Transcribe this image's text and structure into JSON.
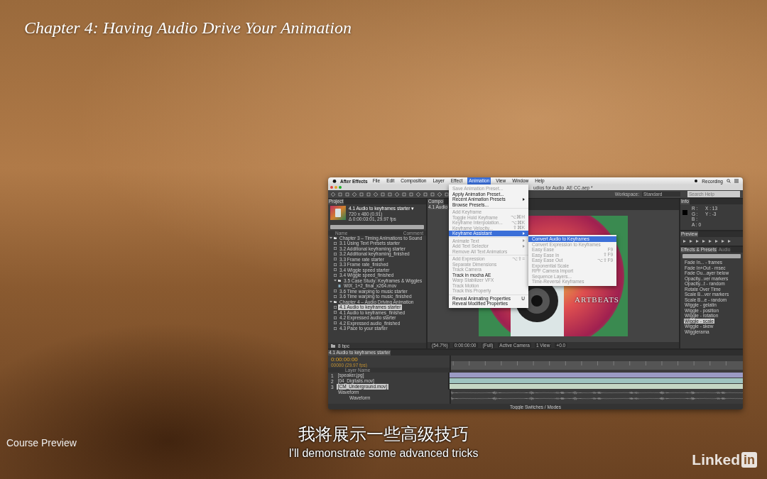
{
  "video_title": "Chapter 4: Having Audio Drive Your Animation",
  "app": {
    "app_name": "After Effects",
    "menus": [
      {
        "label": "File",
        "selected": false
      },
      {
        "label": "Edit",
        "selected": false
      },
      {
        "label": "Composition",
        "selected": false
      },
      {
        "label": "Layer",
        "selected": false
      },
      {
        "label": "Effect",
        "selected": false
      },
      {
        "label": "Animation",
        "selected": true
      },
      {
        "label": "View",
        "selected": false
      },
      {
        "label": "Window",
        "selected": false
      },
      {
        "label": "Help",
        "selected": false
      }
    ],
    "status": "Recording",
    "document_title": "udios for Audio_AE CC.aep *",
    "workspace_label": "Workspace:",
    "workspace": "Standard",
    "search_placeholder": "Search Help"
  },
  "project": {
    "tab": "Project",
    "comp_name": "4.1 Audio to keyframes starter ▾",
    "comp_size": "720 x 480 (0.91)",
    "comp_duration": "Δ 0:00:03:01, 29.97 fps",
    "columns": [
      "Name",
      "Comment"
    ],
    "bpc": "8 bpc",
    "items": [
      {
        "kind": "folder",
        "label": "Chapter 3 – Timing Animations to Sound",
        "expanded": true,
        "selected": false,
        "children": [
          {
            "kind": "comp",
            "label": "3.1 Using Text Presets starter",
            "selected": false
          },
          {
            "kind": "comp",
            "label": "3.2 Additional keyframing starter",
            "selected": false
          },
          {
            "kind": "comp",
            "label": "3.2 Additional keyframing_finished",
            "selected": false
          },
          {
            "kind": "comp",
            "label": "3.3 Frame rate starter",
            "selected": false
          },
          {
            "kind": "comp",
            "label": "3.3 Frame rate_finished",
            "selected": false
          },
          {
            "kind": "comp",
            "label": "3.4 Wiggle speed starter",
            "selected": false
          },
          {
            "kind": "comp",
            "label": "3.4 Wiggle speed_finished",
            "selected": false
          },
          {
            "kind": "folder",
            "label": "3.5 Case Study: Keyframes & Wiggles",
            "expanded": true,
            "selected": false,
            "children": [
              {
                "kind": "file",
                "label": "WIX_1+2_final_x264.mov",
                "selected": false
              }
            ]
          },
          {
            "kind": "comp",
            "label": "3.6 Time warping to music starter",
            "selected": false
          },
          {
            "kind": "comp",
            "label": "3.6 Time warping to music_finished",
            "selected": false
          }
        ]
      },
      {
        "kind": "folder",
        "label": "Chapter 4 – Audio Driving Animation",
        "expanded": true,
        "selected": false,
        "children": [
          {
            "kind": "comp",
            "label": "4.1 Audio to keyframes starter",
            "selected": true
          },
          {
            "kind": "comp",
            "label": "4.1 Audio to keyframes_finished",
            "selected": false
          },
          {
            "kind": "comp",
            "label": "4.2 Expressed audio starter",
            "selected": false
          },
          {
            "kind": "comp",
            "label": "4.2 Expressed audio_finished",
            "selected": false
          },
          {
            "kind": "comp",
            "label": "4.3 Pace to your starter",
            "selected": false
          }
        ]
      }
    ]
  },
  "composition": {
    "tab": "Compo",
    "subtab": "4.1 Audio",
    "artwork_text": "ARTBEATS",
    "footer": [
      "(54.7%)",
      "0:00:00:00",
      "(Full)",
      "Active Camera",
      "1 View",
      "+0.0"
    ]
  },
  "info": {
    "tab": "Info",
    "channels": [
      "R :",
      "G :",
      "B :",
      "A : 0"
    ],
    "coords": [
      "X : 13",
      "Y : -3"
    ]
  },
  "preview": {
    "tab": "Preview"
  },
  "effects": {
    "tabs": [
      {
        "label": "Effects & Presets",
        "selected": true
      },
      {
        "label": "Audio",
        "selected": false
      }
    ],
    "items": [
      {
        "label": "Fade In... - frames",
        "selected": false
      },
      {
        "label": "Fade In+Out - msec",
        "selected": false
      },
      {
        "label": "Fade Ou...ayer below",
        "selected": false
      },
      {
        "label": "Opacity...ver markers",
        "selected": false
      },
      {
        "label": "Opacity...t - random",
        "selected": false
      },
      {
        "label": "Rotate Over Time",
        "selected": false
      },
      {
        "label": "Scale B...ver markers",
        "selected": false
      },
      {
        "label": "Scale B...e - random",
        "selected": false
      },
      {
        "label": "Wiggle - gelatin",
        "selected": false
      },
      {
        "label": "Wiggle - position",
        "selected": false
      },
      {
        "label": "Wiggle - rotation",
        "selected": false
      },
      {
        "label": "Wiggle - scale",
        "selected": true
      },
      {
        "label": "Wiggle - skew",
        "selected": false
      },
      {
        "label": "Wigglerama",
        "selected": false
      }
    ]
  },
  "timeline": {
    "tab": "4.1 Audio to keyframes starter",
    "timecode": "0:00:00:00",
    "fps": "00000 (29.97 fps)",
    "column": "Layer Name",
    "property": "Waveform",
    "subproperty": "Waveform",
    "footer": "Toggle Switches / Modes",
    "layers": [
      {
        "number": "1",
        "name": "[speaker.jpg]",
        "selected": false,
        "color": "#9a9ac4"
      },
      {
        "number": "2",
        "name": "[04_Digitalis.mov]",
        "selected": false,
        "color": "#9fc4c0"
      },
      {
        "number": "3",
        "name": "[CM_Underground.mov]",
        "selected": true,
        "color": "#c4d6c4"
      }
    ]
  },
  "menu": {
    "items": [
      {
        "kind": "item",
        "label": "Save Animation Preset...",
        "disabled": true,
        "selected": false
      },
      {
        "kind": "item",
        "label": "Apply Animation Preset...",
        "disabled": false,
        "selected": false
      },
      {
        "kind": "item",
        "label": "Recent Animation Presets",
        "disabled": false,
        "selected": false,
        "submenu": true
      },
      {
        "kind": "item",
        "label": "Browse Presets...",
        "disabled": false,
        "selected": false
      },
      {
        "kind": "separator"
      },
      {
        "kind": "item",
        "label": "Add Keyframe",
        "disabled": true,
        "selected": false
      },
      {
        "kind": "item",
        "label": "Toggle Hold Keyframe",
        "shortcut": "⌥⌘H",
        "disabled": true,
        "selected": false
      },
      {
        "kind": "item",
        "label": "Keyframe Interpolation...",
        "shortcut": "⌥⌘K",
        "disabled": true,
        "selected": false
      },
      {
        "kind": "item",
        "label": "Keyframe Velocity...",
        "shortcut": "⇧⌘K",
        "disabled": true,
        "selected": false
      },
      {
        "kind": "item",
        "label": "Keyframe Assistant",
        "disabled": false,
        "selected": true,
        "submenu": true
      },
      {
        "kind": "separator"
      },
      {
        "kind": "item",
        "label": "Animate Text",
        "disabled": true,
        "selected": false,
        "submenu": true
      },
      {
        "kind": "item",
        "label": "Add Text Selector",
        "disabled": true,
        "selected": false,
        "submenu": true
      },
      {
        "kind": "item",
        "label": "Remove All Text Animators",
        "disabled": true,
        "selected": false
      },
      {
        "kind": "separator"
      },
      {
        "kind": "item",
        "label": "Add Expression",
        "shortcut": "⌥⇧=",
        "disabled": true,
        "selected": false
      },
      {
        "kind": "item",
        "label": "Separate Dimensions",
        "disabled": true,
        "selected": false
      },
      {
        "kind": "item",
        "label": "Track Camera",
        "disabled": true,
        "selected": false
      },
      {
        "kind": "item",
        "label": "Track in mocha AE",
        "disabled": false,
        "selected": false
      },
      {
        "kind": "item",
        "label": "Warp Stabilizer VFX",
        "disabled": true,
        "selected": false
      },
      {
        "kind": "item",
        "label": "Track Motion",
        "disabled": true,
        "selected": false
      },
      {
        "kind": "item",
        "label": "Track this Property",
        "disabled": true,
        "selected": false
      },
      {
        "kind": "separator"
      },
      {
        "kind": "item",
        "label": "Reveal Animating Properties",
        "shortcut": "U",
        "disabled": false,
        "selected": false
      },
      {
        "kind": "item",
        "label": "Reveal Modified Properties",
        "disabled": false,
        "selected": false
      }
    ]
  },
  "submenu": {
    "items": [
      {
        "label": "Convert Audio to Keyframes",
        "disabled": false,
        "selected": true
      },
      {
        "label": "Convert Expression to Keyframes",
        "disabled": true,
        "selected": false
      },
      {
        "label": "Easy Ease",
        "shortcut": "F9",
        "disabled": true,
        "selected": false
      },
      {
        "label": "Easy Ease In",
        "shortcut": "⇧F9",
        "disabled": true,
        "selected": false
      },
      {
        "label": "Easy Ease Out",
        "shortcut": "⌥⇧F9",
        "disabled": true,
        "selected": false
      },
      {
        "label": "Exponential Scale",
        "disabled": true,
        "selected": false
      },
      {
        "label": "RPF Camera Import",
        "disabled": true,
        "selected": false
      },
      {
        "label": "Sequence Layers...",
        "disabled": true,
        "selected": false
      },
      {
        "label": "Time-Reverse Keyframes",
        "disabled": true,
        "selected": false
      }
    ]
  },
  "subtitles": {
    "chinese": "我将展示一些高级技巧",
    "english": "I'll demonstrate some advanced tricks"
  },
  "course_label": "Course Preview",
  "logo": {
    "word": "Linked",
    "badge": "in"
  }
}
